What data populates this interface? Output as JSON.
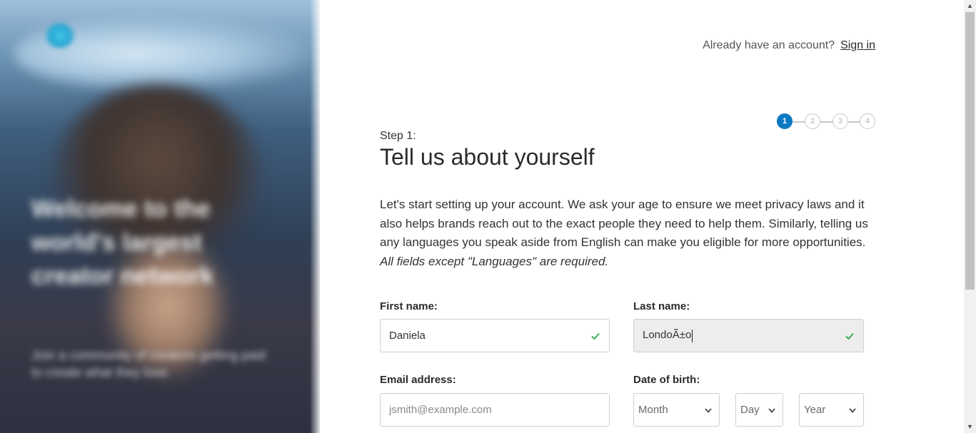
{
  "hero": {
    "headline": "Welcome to the world's largest creator network",
    "subline": "Join a community of creators getting paid to create what they love."
  },
  "header": {
    "account_prompt": "Already have an account?",
    "sign_in_label": "Sign in"
  },
  "stepper": {
    "steps": [
      "1",
      "2",
      "3",
      "4"
    ],
    "active_index": 0,
    "active_color": "#0a79c2"
  },
  "step": {
    "label": "Step 1:",
    "title": "Tell us about yourself"
  },
  "intro": {
    "text": "Let's start setting up your account. We ask your age to ensure we meet privacy laws and it also helps brands reach out to the exact people they need to help them. Similarly, telling us any languages you speak aside from English can make you eligible for more opportunities.",
    "note": "All fields except \"Languages\" are required."
  },
  "form": {
    "first_name": {
      "label": "First name:",
      "value": "Daniela",
      "icon": "check-icon"
    },
    "last_name": {
      "label": "Last name:",
      "value": "LondoÃ±o",
      "icon": "check-icon"
    },
    "email": {
      "label": "Email address:",
      "value": "",
      "placeholder": "jsmith@example.com"
    },
    "dob": {
      "label": "Date of birth:",
      "month": "Month",
      "day": "Day",
      "year": "Year"
    }
  },
  "colors": {
    "check": "#2fa84f",
    "accent": "#0a79c2"
  }
}
